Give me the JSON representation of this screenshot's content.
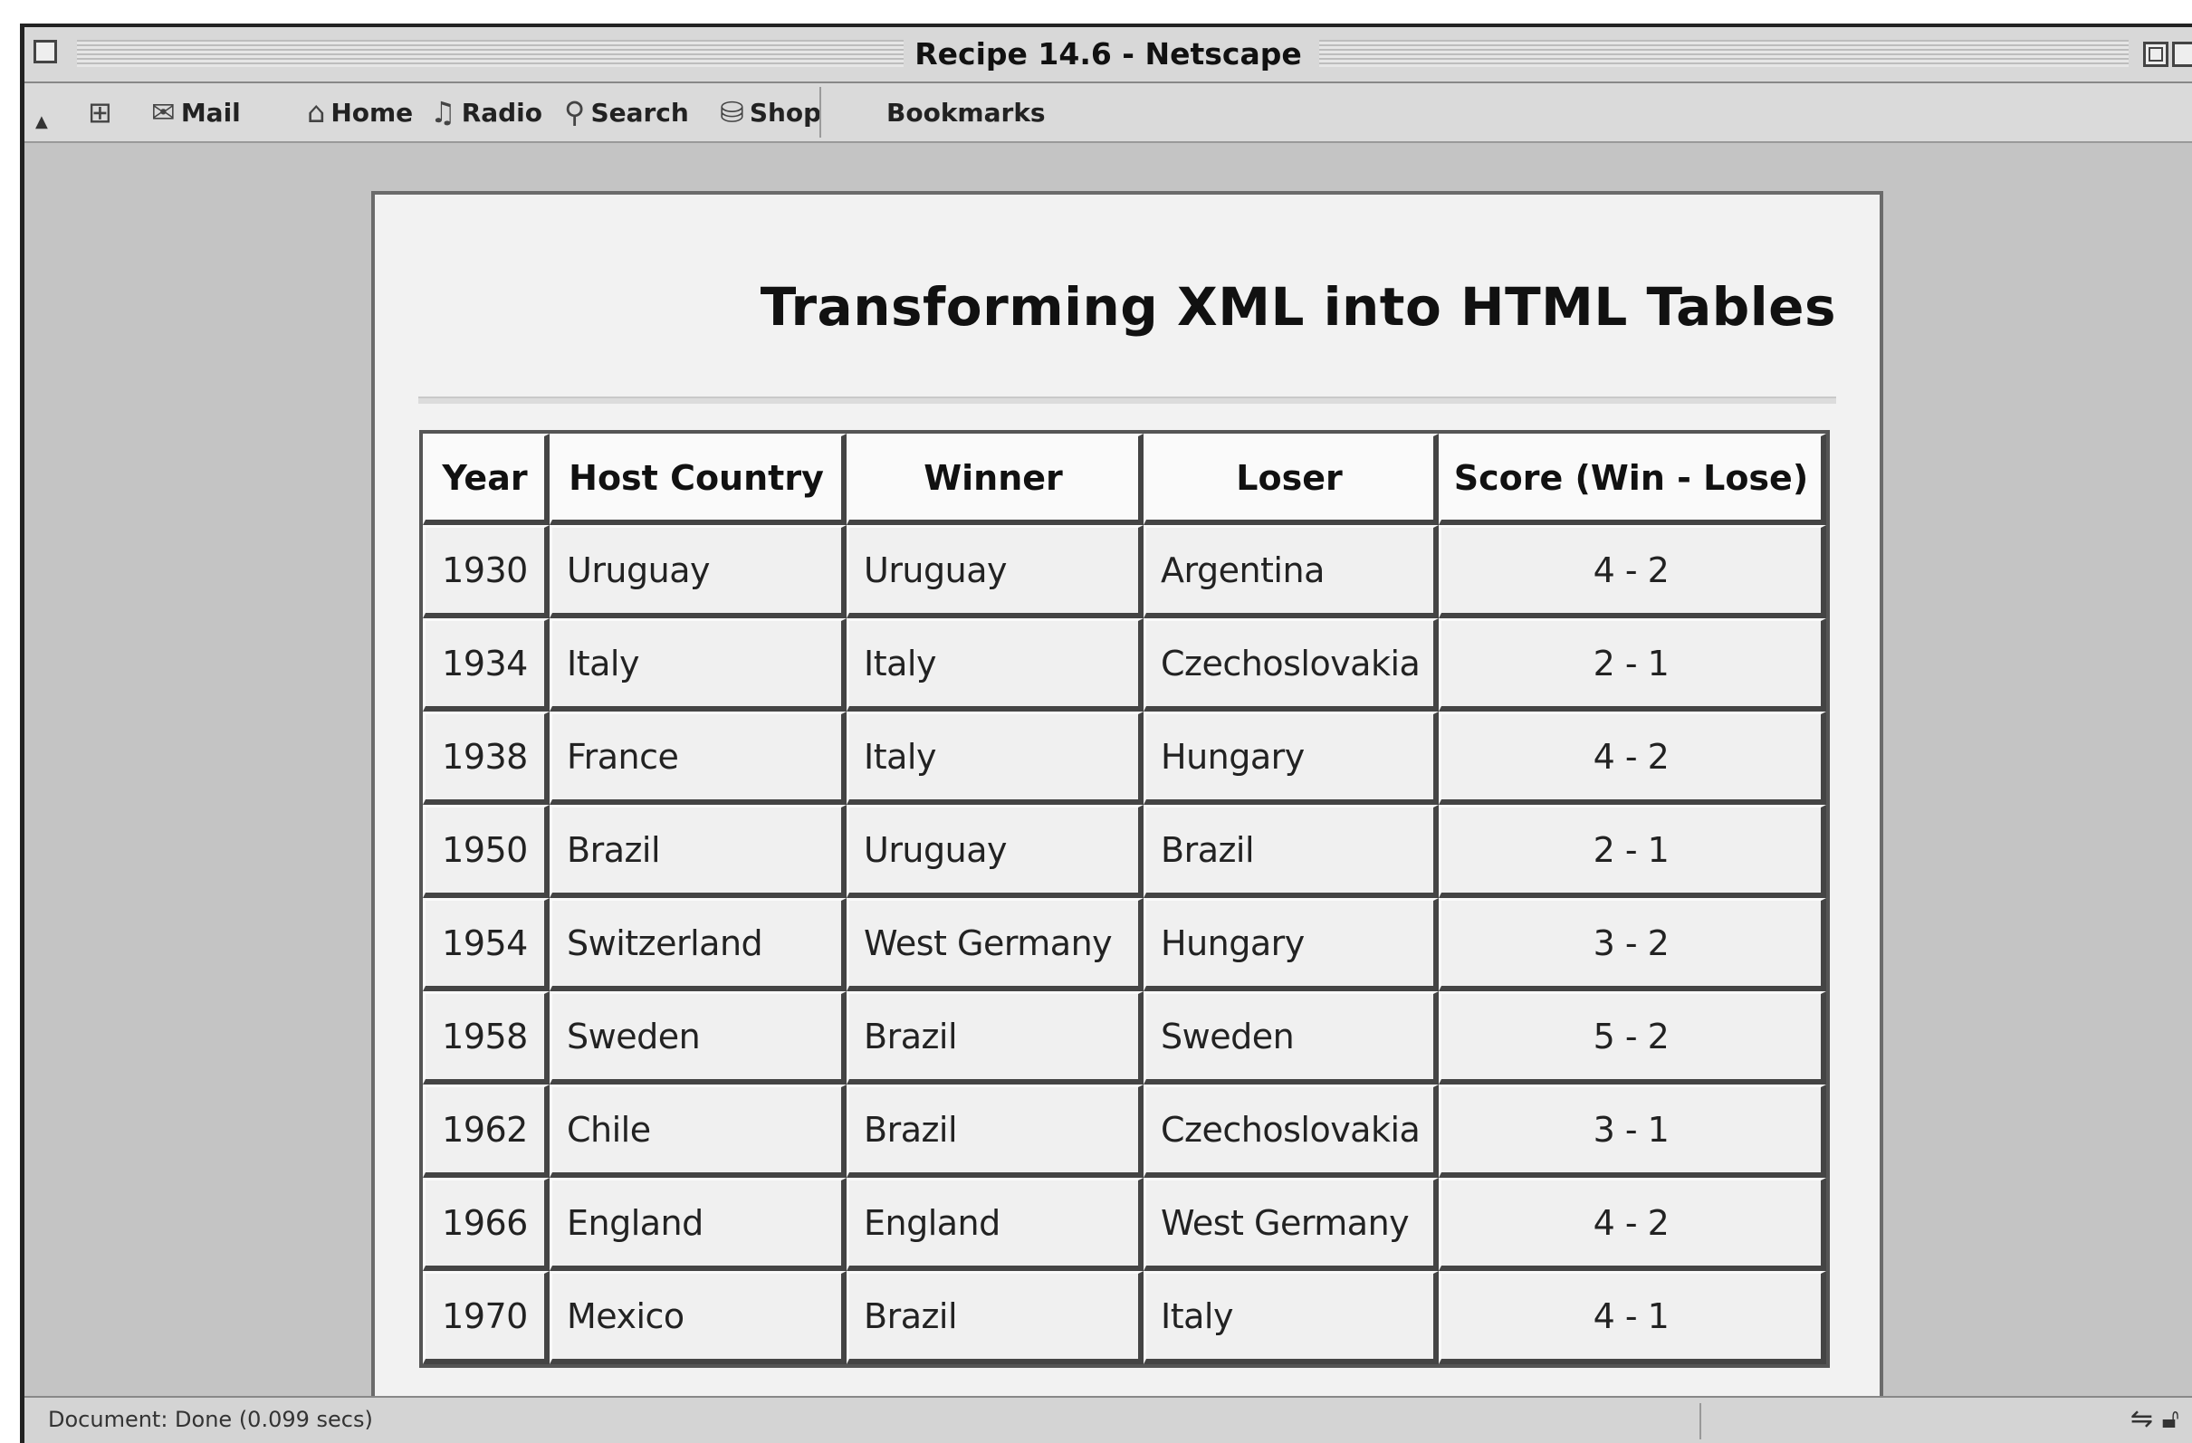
{
  "window": {
    "title": "Recipe 14.6 - Netscape"
  },
  "toolbar": {
    "items": [
      {
        "label": "",
        "icon": "tab-icon"
      },
      {
        "label": "Mail",
        "icon": "mail-icon"
      },
      {
        "label": "Home",
        "icon": "home-icon"
      },
      {
        "label": "Radio",
        "icon": "radio-icon"
      },
      {
        "label": "Search",
        "icon": "search-icon"
      },
      {
        "label": "Shop",
        "icon": "shop-icon"
      }
    ],
    "bookmarks_label": "Bookmarks"
  },
  "page": {
    "heading": "Transforming XML into HTML Tables",
    "table": {
      "headers": [
        "Year",
        "Host Country",
        "Winner",
        "Loser",
        "Score (Win - Lose)"
      ],
      "rows": [
        [
          "1930",
          "Uruguay",
          "Uruguay",
          "Argentina",
          "4 - 2"
        ],
        [
          "1934",
          "Italy",
          "Italy",
          "Czechoslovakia",
          "2 - 1"
        ],
        [
          "1938",
          "France",
          "Italy",
          "Hungary",
          "4 - 2"
        ],
        [
          "1950",
          "Brazil",
          "Uruguay",
          "Brazil",
          "2 - 1"
        ],
        [
          "1954",
          "Switzerland",
          "West Germany",
          "Hungary",
          "3 - 2"
        ],
        [
          "1958",
          "Sweden",
          "Brazil",
          "Sweden",
          "5 - 2"
        ],
        [
          "1962",
          "Chile",
          "Brazil",
          "Czechoslovakia",
          "3 - 1"
        ],
        [
          "1966",
          "England",
          "England",
          "West Germany",
          "4 - 2"
        ],
        [
          "1970",
          "Mexico",
          "Brazil",
          "Italy",
          "4 - 1"
        ]
      ]
    }
  },
  "statusbar": {
    "text": "Document: Done (0.099 secs)"
  }
}
